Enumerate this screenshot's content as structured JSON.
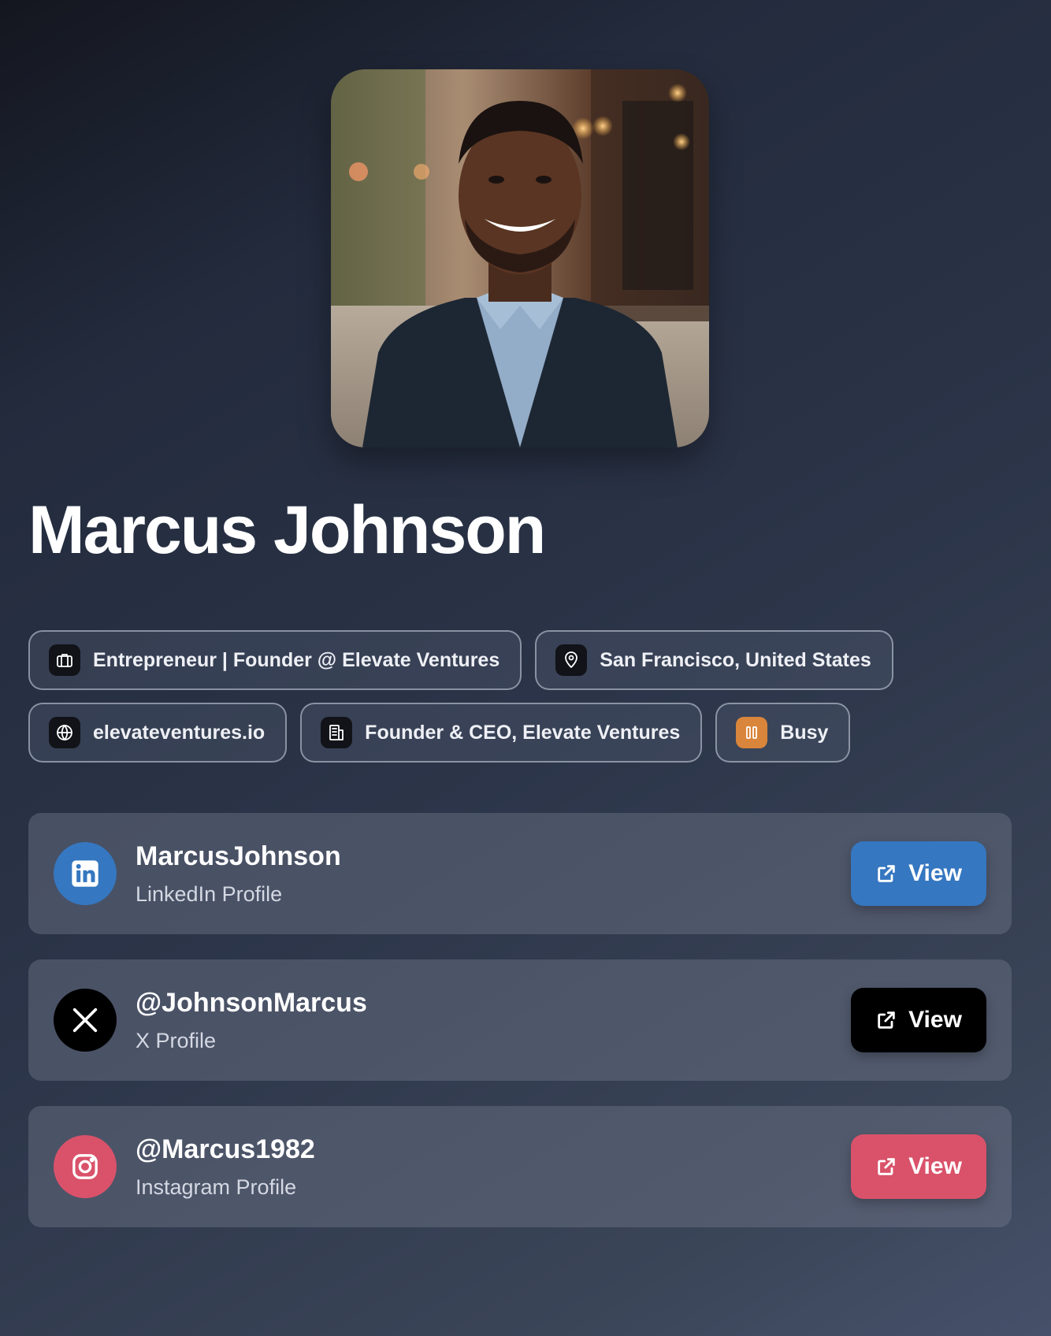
{
  "profile": {
    "name": "Marcus Johnson",
    "photo_alt": "profile-photo"
  },
  "chips": [
    {
      "icon": "briefcase-icon",
      "label": "Entrepreneur | Founder @ Elevate Ventures"
    },
    {
      "icon": "map-pin-icon",
      "label": "San Francisco, United States"
    },
    {
      "icon": "globe-icon",
      "label": "elevateventures.io"
    },
    {
      "icon": "building-icon",
      "label": "Founder & CEO, Elevate Ventures"
    },
    {
      "icon": "pause-icon",
      "label": "Busy",
      "color": "#d9853b"
    }
  ],
  "social": [
    {
      "handle": "MarcusJohnson",
      "subtitle": "LinkedIn Profile",
      "icon": "linkedin-icon",
      "color": "#3577c0",
      "button_label": "View"
    },
    {
      "handle": "@JohnsonMarcus",
      "subtitle": "X Profile",
      "icon": "x-icon",
      "color": "#000000",
      "button_label": "View"
    },
    {
      "handle": "@Marcus1982",
      "subtitle": "Instagram Profile",
      "icon": "instagram-icon",
      "color": "#d9526a",
      "button_label": "View"
    }
  ]
}
